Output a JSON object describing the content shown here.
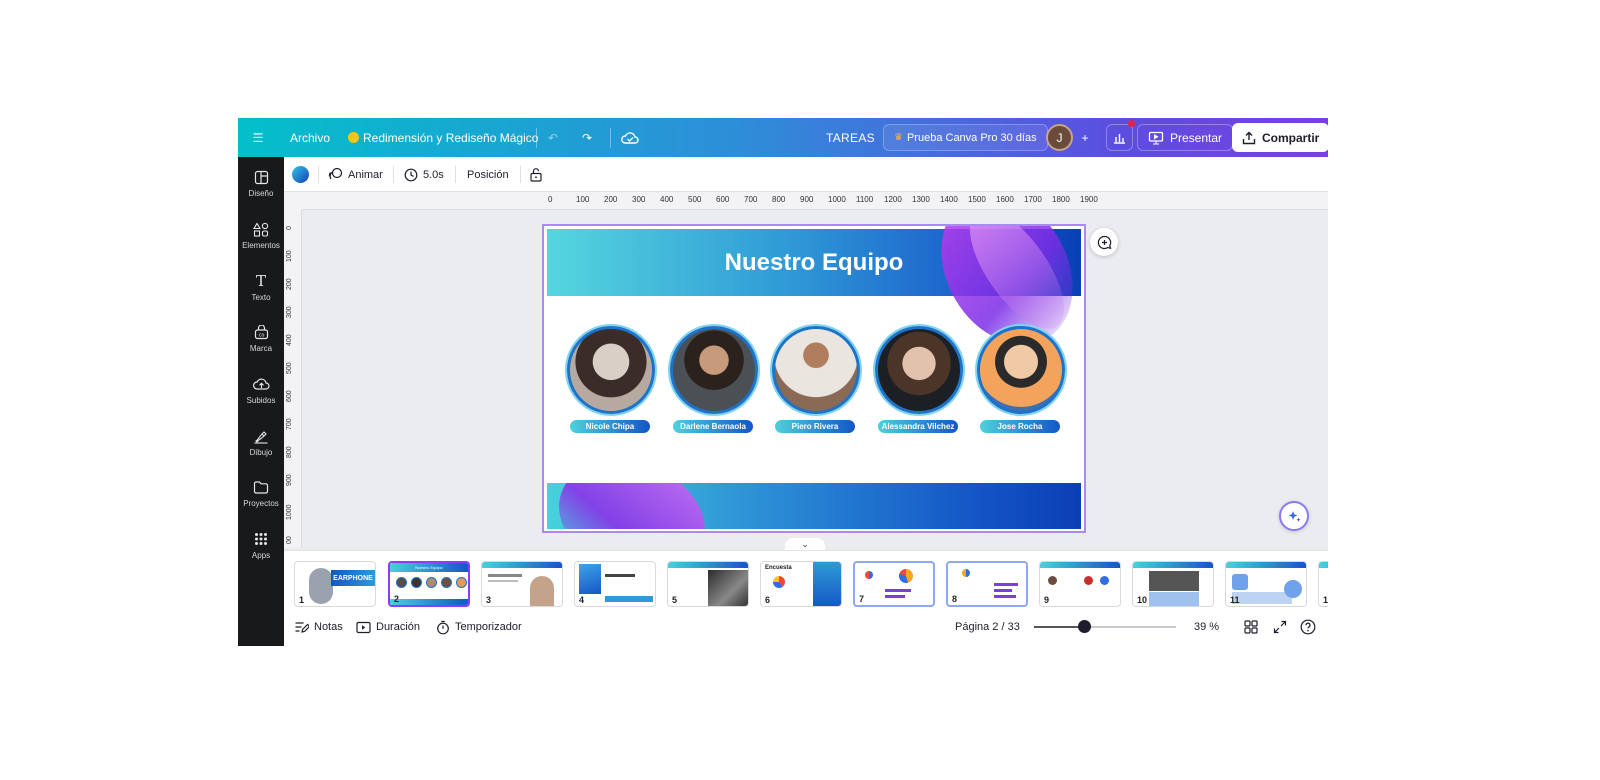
{
  "topbar": {
    "file": "Archivo",
    "resize": "Redimensión y Rediseño Mágico",
    "tasks": "TAREAS",
    "pro_trial": "Prueba Canva Pro 30 días",
    "avatar_initial": "J",
    "present": "Presentar",
    "share": "Compartir"
  },
  "rail": [
    {
      "label": "Diseño",
      "icon": "layout-icon"
    },
    {
      "label": "Elementos",
      "icon": "shapes-icon"
    },
    {
      "label": "Texto",
      "icon": "text-icon"
    },
    {
      "label": "Marca",
      "icon": "brand-icon"
    },
    {
      "label": "Subidos",
      "icon": "upload-cloud-icon"
    },
    {
      "label": "Dibujo",
      "icon": "draw-icon"
    },
    {
      "label": "Proyectos",
      "icon": "folder-icon"
    },
    {
      "label": "Apps",
      "icon": "apps-grid-icon"
    }
  ],
  "ctxbar": {
    "animate": "Animar",
    "duration": "5.0s",
    "position": "Posición"
  },
  "rulers": {
    "horizontal": [
      "0",
      "100",
      "200",
      "300",
      "400",
      "500",
      "600",
      "700",
      "800",
      "900",
      "1000",
      "1100",
      "1200",
      "1300",
      "1400",
      "1500",
      "1600",
      "1700",
      "1800",
      "1900"
    ],
    "vertical": [
      "0",
      "100",
      "200",
      "300",
      "400",
      "500",
      "600",
      "700",
      "800",
      "900",
      "1000",
      "00"
    ]
  },
  "slide": {
    "title": "Nuestro Equipo",
    "members": [
      "Nicole Chipa",
      "Darlene Bernaola",
      "Piero Rivera",
      "Alessandra Vilchez",
      "Jose Rocha"
    ]
  },
  "thumbnails": [
    "1",
    "2",
    "3",
    "4",
    "5",
    "6",
    "7",
    "8",
    "9",
    "10",
    "11",
    "1"
  ],
  "thumb_text": {
    "t1": "EARPHONE",
    "t2": "Nuestro Equipo",
    "t6": "Encuesta"
  },
  "bottombar": {
    "notes": "Notas",
    "duration": "Duración",
    "timer": "Temporizador",
    "page": "Página 2 / 33",
    "zoom": "39 %",
    "zoom_level": 0.35
  },
  "colors": {
    "accent_purple": "#8b3dff",
    "gradient_start": "#03bfca",
    "gradient_end": "#7a3fe2",
    "slide_blue": "#1456c6"
  }
}
